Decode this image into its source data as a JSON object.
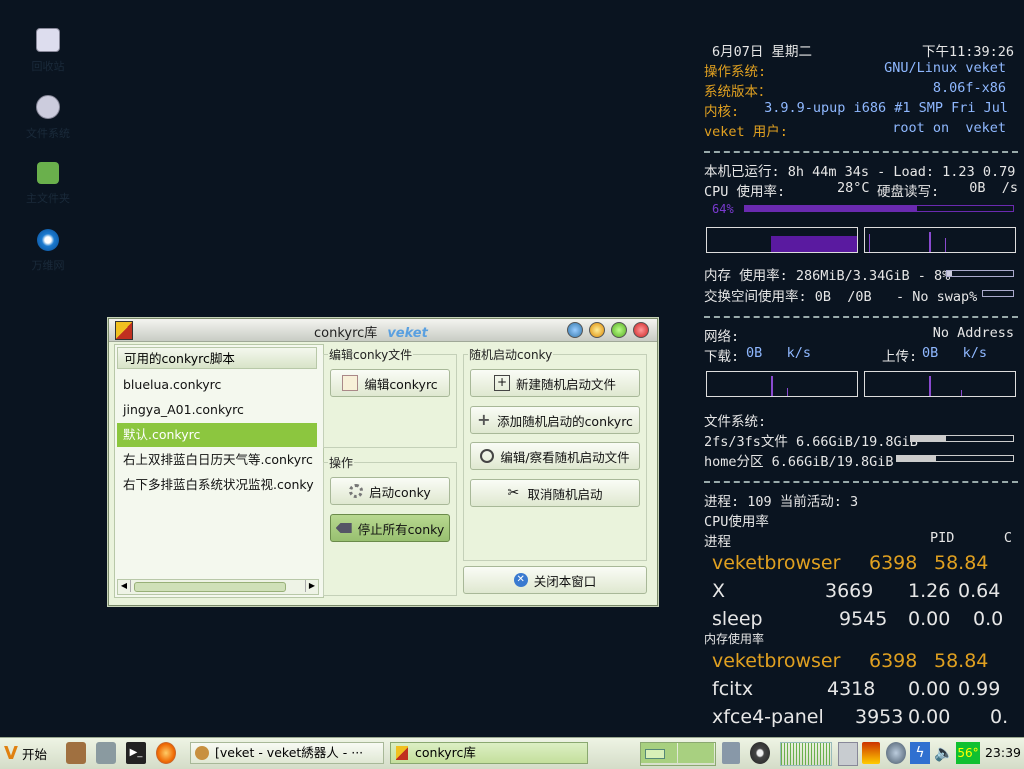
{
  "desktop_icons": [
    {
      "label": "回收站",
      "icon": "trash-icon"
    },
    {
      "label": "文件系统",
      "icon": "drive-icon"
    },
    {
      "label": "主文件夹",
      "icon": "home-folder-icon"
    },
    {
      "label": "万维网",
      "icon": "browser-icon"
    }
  ],
  "conky": {
    "date": "6月07日 星期二",
    "time": "下午11:39:26",
    "os_label": "操作系统:",
    "os_value": "GNU/Linux veket",
    "ver_label": "系统版本：",
    "ver_value": "8.06f-x86",
    "kernel_label": "内核:",
    "kernel_value": "3.9.9-upup i686 #1 SMP Fri Jul",
    "user_label": "veket 用户:",
    "user_value": "root on  veket",
    "uptime_line": "本机已运行: 8h 44m 34s - Load: 1.23 0.79",
    "cpu_line_label": "CPU 使用率:",
    "cpu_temp": "28°C",
    "disk_rw_label": "硬盘读写:",
    "disk_rw_value": "0B  /s",
    "cpu_percent_label": "64%",
    "cpu_percent": 64,
    "mem_line": "内存 使用率: 286MiB/3.34GiB - 8%",
    "mem_percent": 8,
    "swap_line": "交换空间使用率: 0B  /0B   - No swap%",
    "net_label": "网络:",
    "net_value": "No Address",
    "down_label": "下载:",
    "down_value": "0B   k/s",
    "up_label": "上传:",
    "up_value": "0B   k/s",
    "fs_label": "文件系统:",
    "fs1": "2fs/3fs文件 6.66GiB/19.8GiB",
    "fs1_percent": 34,
    "fs2": "home分区 6.66GiB/19.8GiB",
    "fs2_percent": 34,
    "procs_line": "进程: 109 当前活动: 3",
    "cpu_usage_title": "CPU使用率",
    "proc_header": "进程",
    "pid_header": "PID",
    "c_header": "C",
    "cpu_procs": [
      {
        "name": "veketbrowser",
        "pid": "6398",
        "val": "58.84",
        "highlight": true
      },
      {
        "name": "X",
        "pid": "3669",
        "val": "1.26",
        "extra": "0.64"
      },
      {
        "name": "sleep",
        "pid": "9545",
        "val": "0.00",
        "extra": "0.0"
      }
    ],
    "mem_usage_title": "内存使用率",
    "mem_procs": [
      {
        "name": "veketbrowser",
        "pid": "6398",
        "val": "58.84",
        "highlight": true
      },
      {
        "name": "fcitx",
        "pid": "4318",
        "val": "0.00",
        "extra": "0.99"
      },
      {
        "name": "xfce4-panel",
        "pid": "3953",
        "val": "0.00",
        "extra": "0."
      }
    ]
  },
  "window": {
    "title": "conkyrc库",
    "brand": "veket",
    "list_header": "可用的conkyrc脚本",
    "list_items": [
      "bluelua.conkyrc",
      "jingya_A01.conkyrc",
      "默认.conkyrc",
      "右上双排蓝白日历天气等.conkyrc",
      "右下多排蓝白系统状况监视.conky"
    ],
    "selected_index": 2,
    "edit_group": "编辑conky文件",
    "edit_btn": "编辑conkyrc",
    "ops_group": "操作",
    "start_btn": "启动conky",
    "stop_btn": "停止所有conky",
    "auto_group": "随机启动conky",
    "new_auto_btn": "新建随机启动文件",
    "add_auto_btn": "添加随机启动的conkyrc",
    "view_auto_btn": "编辑/察看随机启动文件",
    "cancel_auto_btn": "取消随机启动",
    "close_btn": "关闭本窗口"
  },
  "taskbar": {
    "start_label": "开始",
    "task1": "[veket - veket綉器人 - ···",
    "task2": "conkyrc库",
    "temp": "56°",
    "clock": "23:39"
  },
  "colors": {
    "accent_orange": "#e0a020",
    "accent_blue": "#8fb8ff",
    "window_bg": "#eaf3dc",
    "selection": "#8cc63f"
  }
}
